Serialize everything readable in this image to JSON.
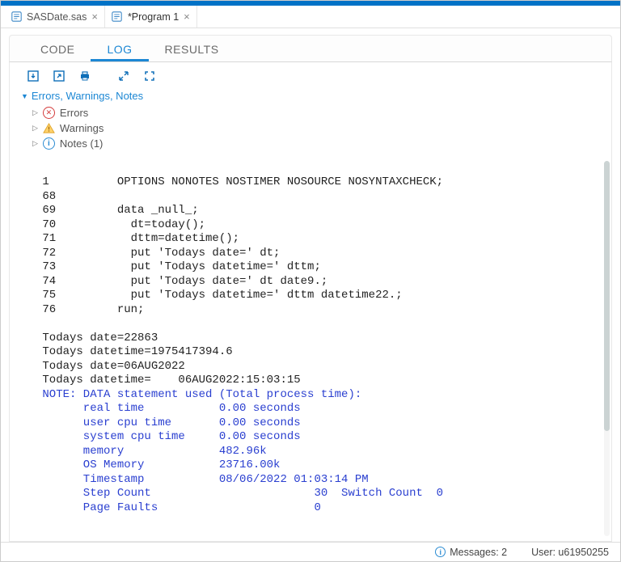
{
  "file_tabs": [
    {
      "label": "SASDate.sas",
      "active": false
    },
    {
      "label": "*Program 1",
      "active": true
    }
  ],
  "sub_tabs": {
    "code": "CODE",
    "log": "LOG",
    "results": "RESULTS",
    "active": "log"
  },
  "outline": {
    "header": "Errors, Warnings, Notes",
    "errors_label": "Errors",
    "warnings_label": "Warnings",
    "notes_label": "Notes (1)"
  },
  "log": {
    "plain": " 1          OPTIONS NONOTES NOSTIMER NOSOURCE NOSYNTAXCHECK;\n 68         \n 69         data _null_;\n 70           dt=today();\n 71           dttm=datetime();\n 72           put 'Todays date=' dt;\n 73           put 'Todays datetime=' dttm;\n 74           put 'Todays date=' dt date9.;\n 75           put 'Todays datetime=' dttm datetime22.;\n 76         run;\n \n Todays date=22863\n Todays datetime=1975417394.6\n Todays date=06AUG2022\n Todays datetime=    06AUG2022:15:03:15",
    "note": " NOTE: DATA statement used (Total process time):\n       real time           0.00 seconds\n       user cpu time       0.00 seconds\n       system cpu time     0.00 seconds\n       memory              482.96k\n       OS Memory           23716.00k\n       Timestamp           08/06/2022 01:03:14 PM\n       Step Count                        30  Switch Count  0\n       Page Faults                       0"
  },
  "status": {
    "messages_label": "Messages: 2",
    "user_label": "User: u61950255"
  }
}
